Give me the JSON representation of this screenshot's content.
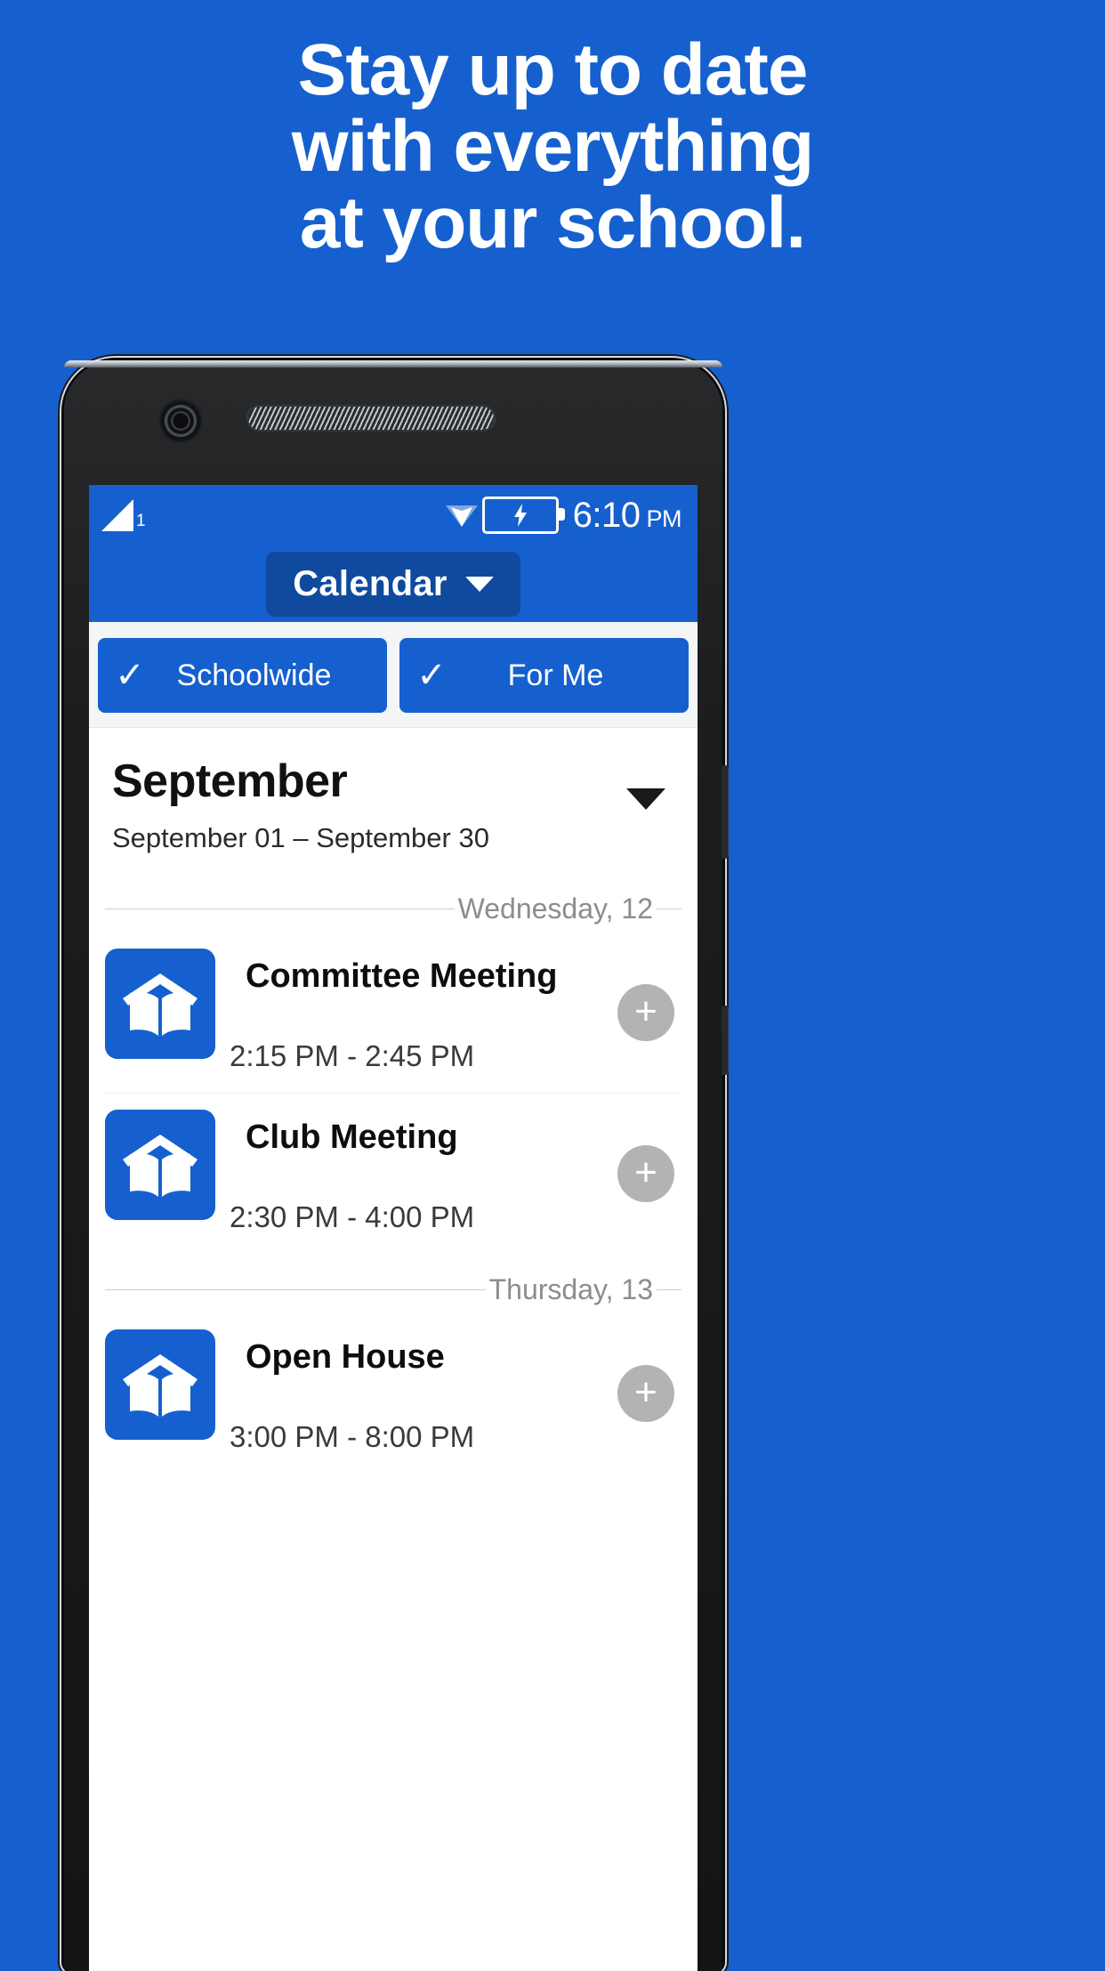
{
  "promo": {
    "background_color": "#1560ce",
    "headline_lines": [
      "Stay up to date",
      "with everything",
      "at your school."
    ]
  },
  "phone": {
    "status_bar": {
      "signal_icon": "signal-triangle-icon",
      "signal_slot": "1",
      "wifi_icon": "wifi-icon",
      "battery_icon": "battery-charging-icon",
      "time": "6:10",
      "ampm": "PM"
    },
    "title_bar": {
      "title": "Calendar",
      "chevron_icon": "chevron-down-icon"
    },
    "filters": [
      {
        "label": "Schoolwide",
        "checked": true,
        "check_glyph": "✓"
      },
      {
        "label": "For Me",
        "checked": true,
        "check_glyph": "✓"
      }
    ],
    "month_header": {
      "month": "September",
      "range": "September 01 – September 30",
      "expand_icon": "triangle-down-icon"
    },
    "sections": [
      {
        "day_label": "Wednesday, 12",
        "events": [
          {
            "title": "Committee Meeting",
            "time": "2:15 PM - 2:45 PM",
            "icon": "school-book-icon",
            "add_glyph": "+"
          },
          {
            "title": "Club Meeting",
            "time": "2:30 PM - 4:00 PM",
            "icon": "school-book-icon",
            "add_glyph": "+"
          }
        ]
      },
      {
        "day_label": "Thursday, 13",
        "events": [
          {
            "title": "Open House",
            "time": "3:00 PM - 8:00 PM",
            "icon": "school-book-icon",
            "add_glyph": "+"
          }
        ]
      }
    ]
  },
  "colors": {
    "brand_blue": "#1560ce",
    "title_pill_blue": "#0f4a9e",
    "chip_blue": "#1560ce",
    "divider_gray": "#cfcfcf",
    "add_button_gray": "#b3b3b3"
  }
}
